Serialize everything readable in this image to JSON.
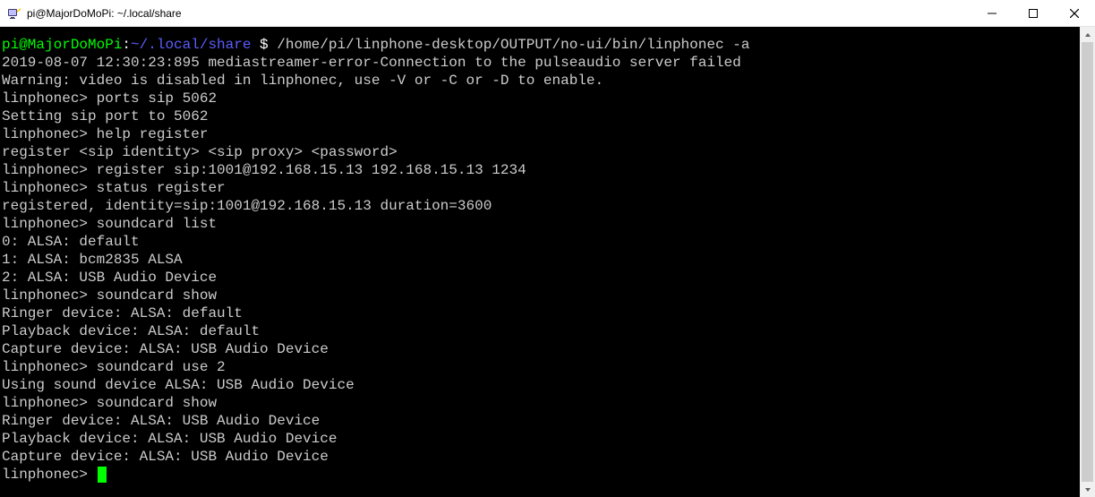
{
  "window": {
    "title": "pi@MajorDoMoPi: ~/.local/share"
  },
  "prompt": {
    "user_host": "pi@MajorDoMoPi",
    "sep": ":",
    "cwd": "~/.local/share",
    "dollar": " $ ",
    "command": "/home/pi/linphone-desktop/OUTPUT/no-ui/bin/linphonec -a"
  },
  "lines": [
    "2019-08-07 12:30:23:895 mediastreamer-error-Connection to the pulseaudio server failed",
    "Warning: video is disabled in linphonec, use -V or -C or -D to enable.",
    "linphonec> ports sip 5062",
    "Setting sip port to 5062",
    "linphonec> help register",
    "register <sip identity> <sip proxy> <password>",
    "linphonec> register sip:1001@192.168.15.13 192.168.15.13 1234",
    "linphonec> status register",
    "registered, identity=sip:1001@192.168.15.13 duration=3600",
    "linphonec> soundcard list",
    "0: ALSA: default",
    "1: ALSA: bcm2835 ALSA",
    "2: ALSA: USB Audio Device",
    "linphonec> soundcard show",
    "Ringer device: ALSA: default",
    "Playback device: ALSA: default",
    "Capture device: ALSA: USB Audio Device",
    "linphonec> soundcard use 2",
    "Using sound device ALSA: USB Audio Device",
    "linphonec> soundcard show",
    "Ringer device: ALSA: USB Audio Device",
    "Playback device: ALSA: USB Audio Device",
    "Capture device: ALSA: USB Audio Device"
  ],
  "final_prompt": "linphonec> "
}
